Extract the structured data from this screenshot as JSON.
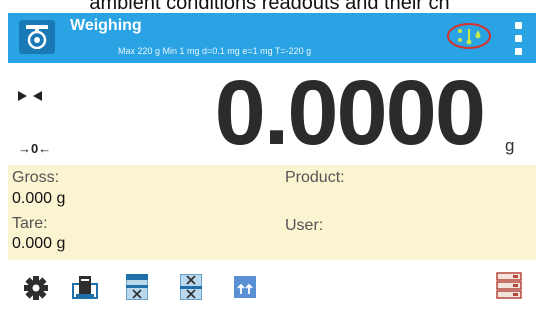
{
  "caption": "ambient conditions readouts and their ch",
  "header": {
    "title": "Weighing",
    "subtitle": "Max 220 g  Min 1 mg  d=0.1 mg  e=1 mg  T=-220 g",
    "app_icon": "scale-icon",
    "ambient_icon": "ambient-conditions-icon",
    "menu_icon": "kebab-menu-icon",
    "color": "#29a3e3"
  },
  "readout": {
    "value": "0.0000",
    "unit": "g",
    "zero_indicator": "→0←",
    "stability_icon": "stable-indicator-icon"
  },
  "info": {
    "gross_label": "Gross:",
    "gross_value": "0.000 g",
    "tare_label": "Tare:",
    "tare_value": "0.000 g",
    "product_label": "Product:",
    "user_label": "User:",
    "background": "#fbf4d1"
  },
  "toolbar": {
    "buttons": [
      "settings-icon",
      "printer-icon",
      "form-a-icon",
      "form-b-icon",
      "report-icon",
      "database-icon"
    ]
  }
}
